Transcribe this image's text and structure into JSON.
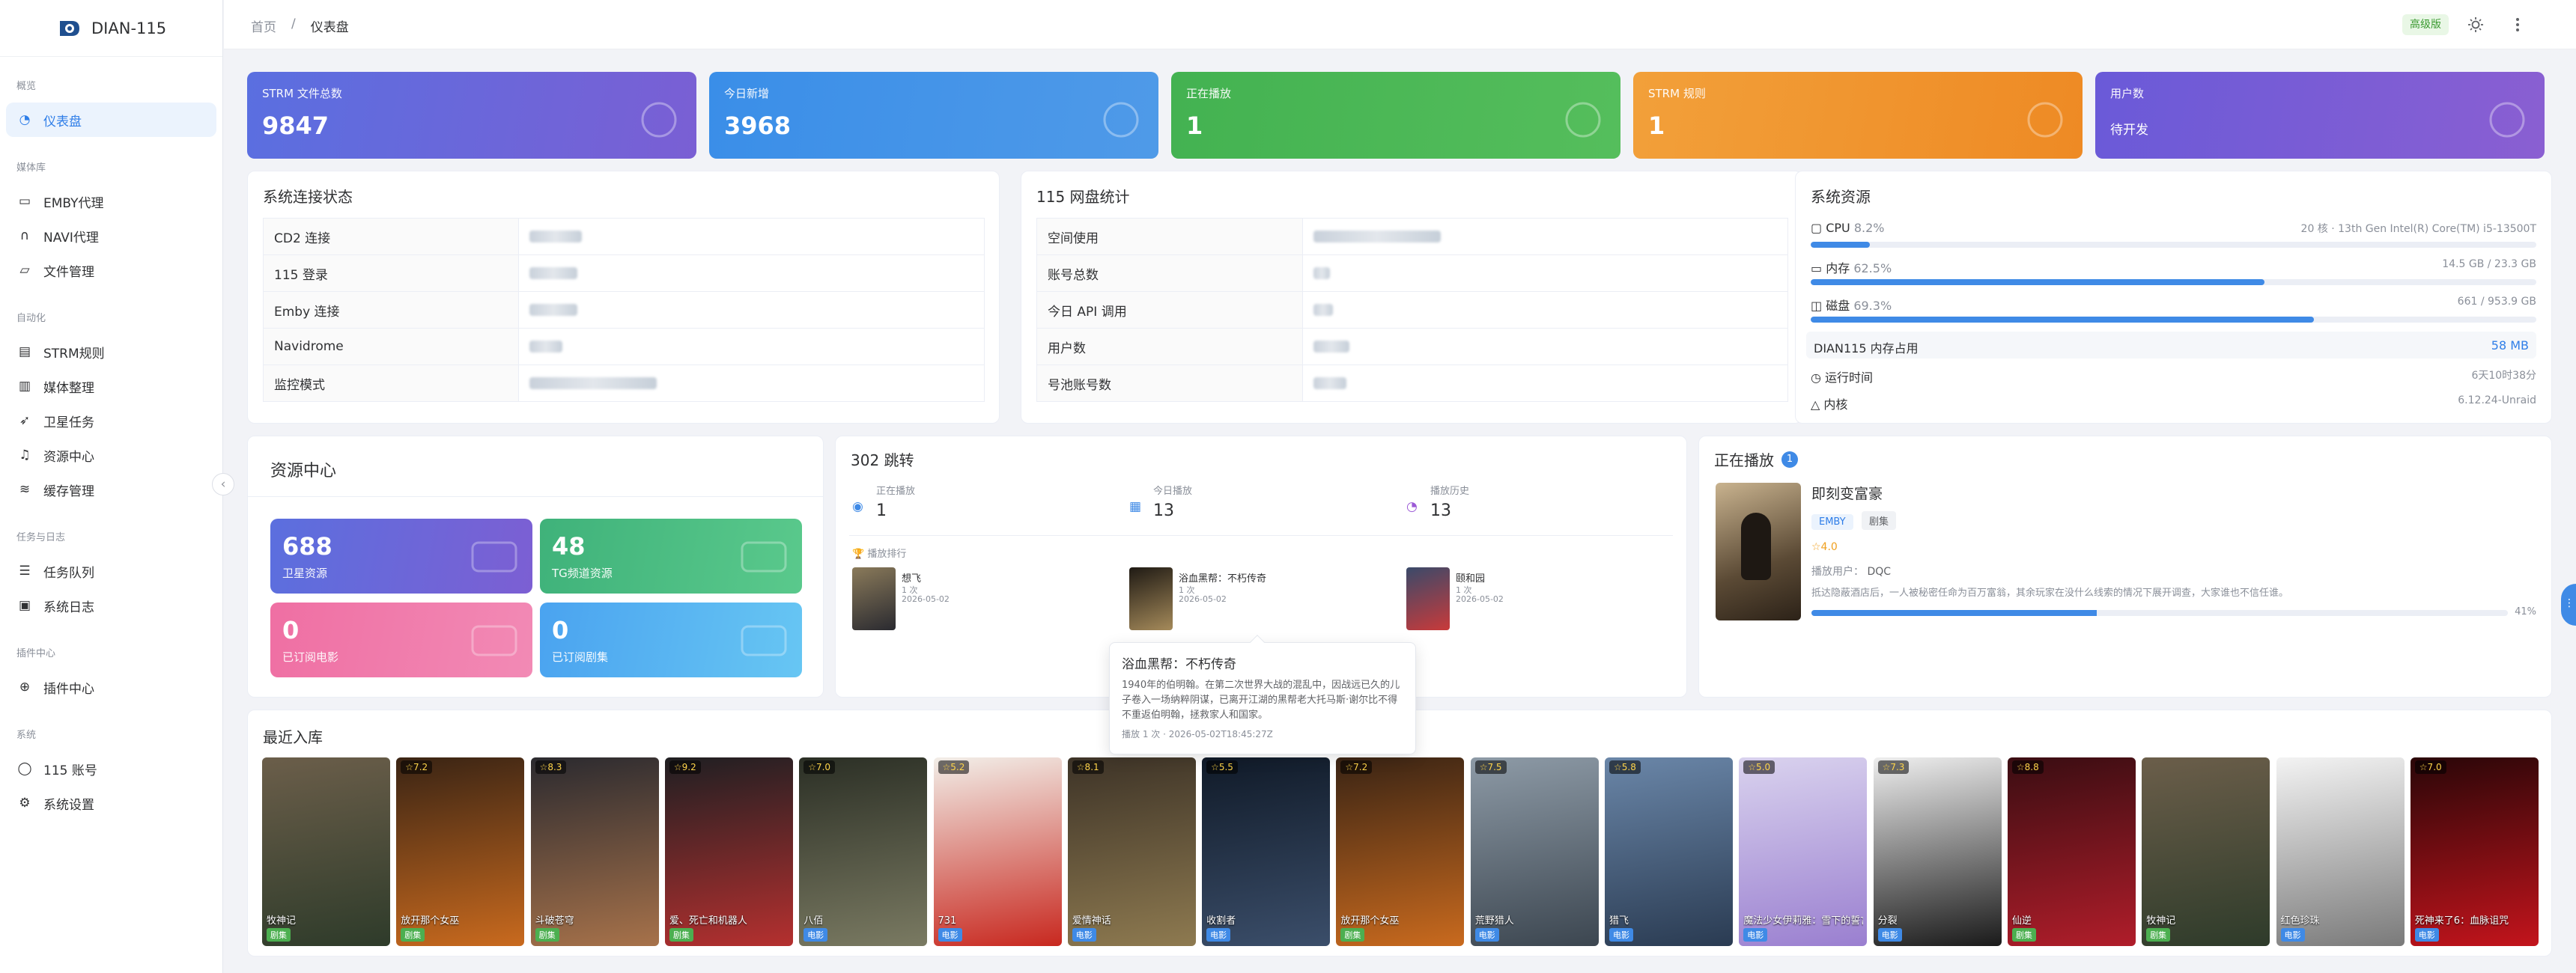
{
  "app": {
    "name": "DIAN-115"
  },
  "sidebar": {
    "groups": [
      {
        "title": "概览",
        "items": [
          {
            "label": "仪表盘",
            "icon": "dashboard-icon",
            "active": true
          }
        ]
      },
      {
        "title": "媒体库",
        "items": [
          {
            "label": "EMBY代理",
            "icon": "monitor-icon"
          },
          {
            "label": "NAVI代理",
            "icon": "headphones-icon"
          },
          {
            "label": "文件管理",
            "icon": "folder-icon"
          }
        ]
      },
      {
        "title": "自动化",
        "items": [
          {
            "label": "STRM规则",
            "icon": "document-icon"
          },
          {
            "label": "媒体整理",
            "icon": "film-icon"
          },
          {
            "label": "卫星任务",
            "icon": "rocket-icon"
          },
          {
            "label": "资源中心",
            "icon": "bell-icon"
          },
          {
            "label": "缓存管理",
            "icon": "database-icon"
          }
        ]
      },
      {
        "title": "任务与日志",
        "items": [
          {
            "label": "任务队列",
            "icon": "list-icon"
          },
          {
            "label": "系统日志",
            "icon": "log-icon"
          }
        ]
      },
      {
        "title": "插件中心",
        "items": [
          {
            "label": "插件中心",
            "icon": "plugin-icon"
          }
        ]
      },
      {
        "title": "系统",
        "items": [
          {
            "label": "115 账号",
            "icon": "user-icon"
          },
          {
            "label": "系统设置",
            "icon": "gear-icon"
          }
        ]
      }
    ]
  },
  "topbar": {
    "breadcrumb": [
      "首页",
      "/",
      "仪表盘"
    ],
    "badge": "高级版"
  },
  "stats": [
    {
      "label": "STRM 文件总数",
      "value": "9847",
      "color": "#6a5fd8",
      "icon": "file-icon"
    },
    {
      "label": "今日新增",
      "value": "3968",
      "color": "#3b8ee6",
      "icon": "plus-circle-icon"
    },
    {
      "label": "正在播放",
      "value": "1",
      "color": "#45b552",
      "icon": "play-icon"
    },
    {
      "label": "STRM 规则",
      "value": "1",
      "color": "#f0962d",
      "icon": "list-icon"
    },
    {
      "label": "用户数",
      "value": "待开发",
      "color": "#6d5bd6",
      "icon": "users-icon"
    }
  ],
  "connection": {
    "title": "系统连接状态",
    "rows": [
      {
        "key": "CD2 连接"
      },
      {
        "key": "115 登录"
      },
      {
        "key": "Emby 连接"
      },
      {
        "key": "Navidrome"
      },
      {
        "key": "监控模式"
      }
    ]
  },
  "pan115": {
    "title": "115 网盘统计",
    "rows": [
      {
        "key": "空间使用"
      },
      {
        "key": "账号总数"
      },
      {
        "key": "今日 API 调用"
      },
      {
        "key": "用户数"
      },
      {
        "key": "号池账号数"
      }
    ]
  },
  "resources": {
    "title": "系统资源",
    "cpu": {
      "label": "CPU",
      "pct_text": "8.2%",
      "pct": 8.2,
      "detail": "20 核 · 13th Gen Intel(R) Core(TM) i5-13500T"
    },
    "mem": {
      "label": "内存",
      "pct_text": "62.5%",
      "pct": 62.5,
      "detail": "14.5 GB / 23.3 GB"
    },
    "disk": {
      "label": "磁盘",
      "pct_text": "69.3%",
      "pct": 69.3,
      "detail": "661 / 953.9 GB"
    },
    "app_mem": {
      "label": "DIAN115 内存占用",
      "value": "58 MB"
    },
    "uptime": {
      "label": "运行时间",
      "value": "6天10时38分"
    },
    "kernel": {
      "label": "内核",
      "value": "6.12.24-Unraid"
    }
  },
  "resource_center": {
    "title": "资源中心",
    "tiles": [
      {
        "value": "688",
        "label": "卫星资源",
        "icon": "cloud-icon"
      },
      {
        "value": "48",
        "label": "TG频道资源",
        "icon": "send-icon"
      },
      {
        "value": "0",
        "label": "已订阅电影",
        "icon": "film-icon"
      },
      {
        "value": "0",
        "label": "已订阅剧集",
        "icon": "tv-icon"
      }
    ]
  },
  "redirect302": {
    "title": "302 跳转",
    "now_label": "正在播放",
    "now_value": "1",
    "today_label": "今日播放",
    "today_value": "13",
    "history_label": "播放历史",
    "history_value": "13",
    "rank_label": "播放排行",
    "rank": [
      {
        "title": "想飞",
        "count": "1 次",
        "date": "2026-05-02"
      },
      {
        "title": "浴血黑帮：不朽传奇",
        "count": "1 次",
        "date": "2026-05-02"
      },
      {
        "title": "颐和园",
        "count": "1 次",
        "date": "2026-05-02"
      }
    ],
    "tooltip": {
      "title": "浴血黑帮：不朽传奇",
      "desc": "1940年的伯明翰。在第二次世界大战的混乱中，因战远已久的儿子卷入一场纳粹阴谋，已离开江湖的黑帮老大托马斯·谢尔比不得不重返伯明翰，拯救家人和国家。",
      "meta": "播放 1 次 · 2026-05-02T18:45:27Z"
    }
  },
  "now_playing": {
    "title": "正在播放",
    "count": "1",
    "show": "即刻变富豪",
    "tags": [
      "EMBY",
      "剧集"
    ],
    "rating": "☆4.0",
    "user_label": "播放用户：",
    "user": "DQC",
    "desc": "抵达隐蔽酒店后，一人被秘密任命为百万富翁，其余玩家在没什么线索的情况下展开调查，大家谁也不信任谁。",
    "progress_text": "41%",
    "progress": 41
  },
  "recent": {
    "title": "最近入库",
    "items": [
      {
        "title": "牧神记",
        "rating": "",
        "type": "剧集",
        "c1": "#6b5e4a",
        "c2": "#2e3b2a"
      },
      {
        "title": "放开那个女巫",
        "rating": "☆7.2",
        "type": "剧集",
        "c1": "#3a2414",
        "c2": "#c96a1e"
      },
      {
        "title": "斗破苍穹",
        "rating": "☆8.3",
        "type": "剧集",
        "c1": "#2b2a2f",
        "c2": "#a7724a"
      },
      {
        "title": "爱、死亡和机器人",
        "rating": "☆9.2",
        "type": "剧集",
        "c1": "#1f1f22",
        "c2": "#b5302f"
      },
      {
        "title": "八佰",
        "rating": "☆7.0",
        "type": "电影",
        "c1": "#2b2f25",
        "c2": "#7a7a62"
      },
      {
        "title": "731",
        "rating": "☆5.2",
        "type": "电影",
        "c1": "#f2eee8",
        "c2": "#c8281f"
      },
      {
        "title": "爱情神话",
        "rating": "☆8.1",
        "type": "电影",
        "c1": "#3d3327",
        "c2": "#8e7a50"
      },
      {
        "title": "收割者",
        "rating": "☆5.5",
        "type": "电影",
        "c1": "#101a28",
        "c2": "#3b4e6a"
      },
      {
        "title": "放开那个女巫",
        "rating": "☆7.2",
        "type": "剧集",
        "c1": "#3a2414",
        "c2": "#c96a1e"
      },
      {
        "title": "荒野猎人",
        "rating": "☆7.5",
        "type": "电影",
        "c1": "#8d9aa6",
        "c2": "#3c4650"
      },
      {
        "title": "猎飞",
        "rating": "☆5.8",
        "type": "电影",
        "c1": "#6a86a8",
        "c2": "#2a3b52"
      },
      {
        "title": "魔法少女伊莉雅：雪下的誓言 重樱的炫翼",
        "rating": "☆5.0",
        "type": "电影",
        "c1": "#d9d2ee",
        "c2": "#9a7fd0"
      },
      {
        "title": "分裂",
        "rating": "☆7.3",
        "type": "电影",
        "c1": "#eeeeee",
        "c2": "#1a1a1a"
      },
      {
        "title": "仙逆",
        "rating": "☆8.8",
        "type": "剧集",
        "c1": "#3a0d12",
        "c2": "#b01d2a"
      },
      {
        "title": "牧神记",
        "rating": "",
        "type": "剧集",
        "c1": "#6b5e4a",
        "c2": "#2e3b2a"
      },
      {
        "title": "红色珍珠",
        "rating": "",
        "type": "电影",
        "c1": "#f3f3f3",
        "c2": "#7a7a7a"
      },
      {
        "title": "死神来了6：血脉诅咒",
        "rating": "☆7.0",
        "type": "电影",
        "c1": "#2a0608",
        "c2": "#c3141c"
      }
    ]
  }
}
